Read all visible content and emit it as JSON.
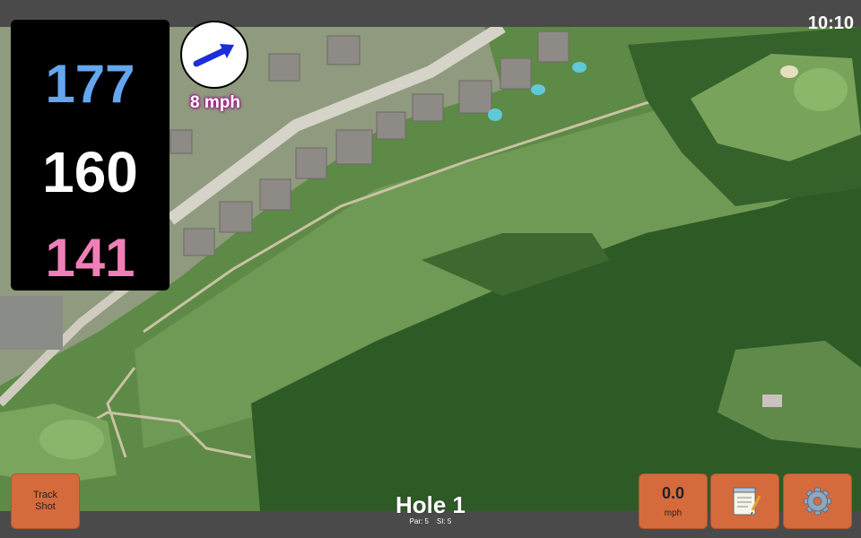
{
  "status": {
    "time": "10:10"
  },
  "distances": {
    "back": "177",
    "middle": "160",
    "front": "141",
    "colors": {
      "back": "#64a6f0",
      "middle": "#ffffff",
      "front": "#f07fb8"
    }
  },
  "wind": {
    "speed_label": "8 mph",
    "icon": "wind-arrow-icon",
    "arrow_color": "#1b2ed8"
  },
  "hole": {
    "title": "Hole 1",
    "par_label": "Par: 5",
    "si_label": "SI: 5"
  },
  "buttons": {
    "track_line1": "Track",
    "track_line2": "Shot",
    "speed_value": "0.0",
    "speed_unit": "mph",
    "notes_icon": "notepad-icon",
    "settings_icon": "gear-icon",
    "accent": "#d56b3d"
  }
}
